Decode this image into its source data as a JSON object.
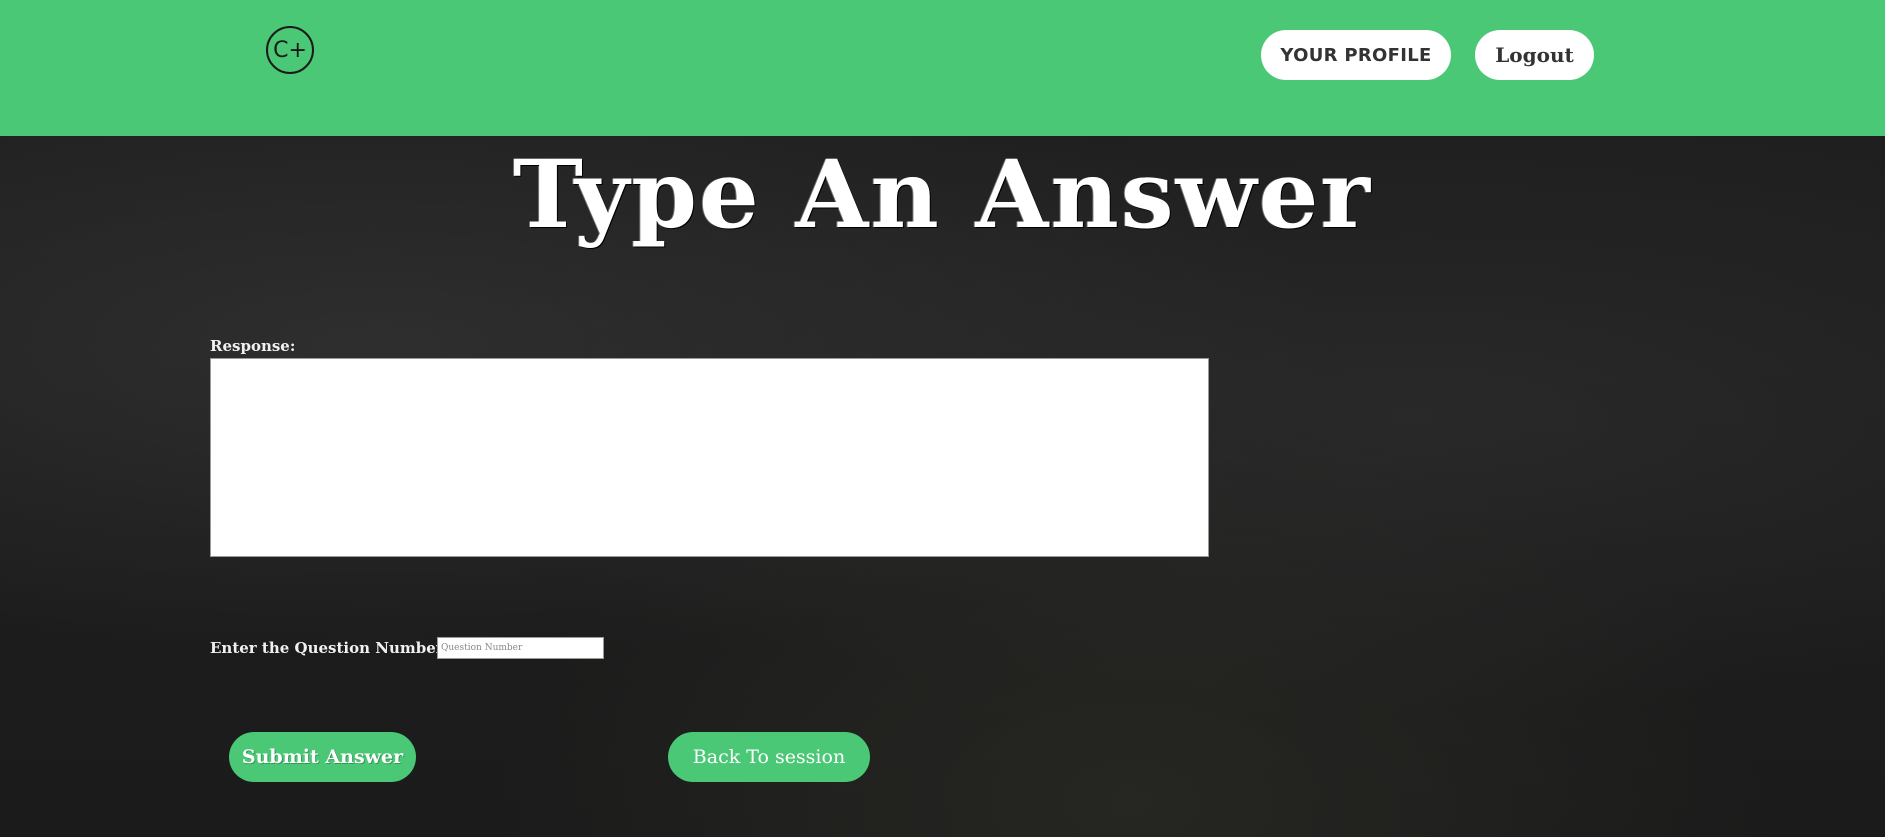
{
  "header": {
    "logo_text": "C+",
    "profile_label": "YOUR PROFILE",
    "logout_label": "Logout"
  },
  "main": {
    "title": "Type An Answer",
    "response_label": "Response:",
    "response_value": "",
    "question_number_label": "Enter the Question Number:",
    "question_number_placeholder": "Question Number",
    "question_number_value": "",
    "submit_label": "Submit Answer",
    "back_label": "Back To session"
  },
  "colors": {
    "accent": "#4ac876",
    "background": "#1c1c1c",
    "button_text_dark": "#333333"
  }
}
